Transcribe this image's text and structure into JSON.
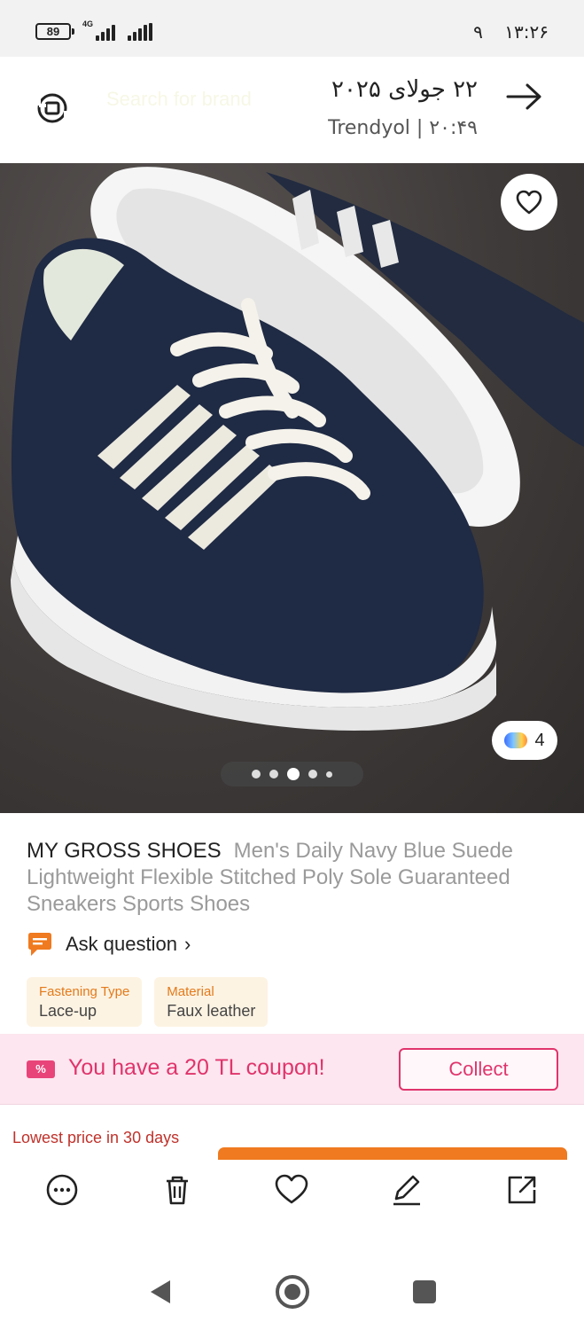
{
  "status_bar": {
    "battery": "89",
    "network": "4G",
    "time": "۱۳:۲۶",
    "notification_count": "۹"
  },
  "header": {
    "date": "۲۲ جولای ۲۰۲۵",
    "source": "Trendyol | ۲۰:۴۹",
    "ghost_search": "Search for brand"
  },
  "gallery": {
    "colors_count": "4",
    "pages": 5,
    "active_page": 3
  },
  "product": {
    "brand": "MY GROSS SHOES",
    "name": "Men's Daily Navy Blue Suede Lightweight Flexible Stitched Poly Sole Guaranteed Sneakers Sports Shoes",
    "ask_label": "Ask question",
    "attributes": [
      {
        "name": "Fastening Type",
        "value": "Lace-up"
      },
      {
        "name": "Material",
        "value": "Faux leather"
      }
    ]
  },
  "coupon": {
    "icon_text": "%",
    "text": "You have a 20 TL coupon!",
    "button": "Collect"
  },
  "price": {
    "lowest_label": "Lowest price in 30 days"
  },
  "colors": {
    "accent_orange": "#ef7a1f",
    "coupon_pink": "#e0346c",
    "lowest_red": "#c0322b"
  },
  "toolbar_icons": [
    "more-icon",
    "trash-icon",
    "heart-icon",
    "edit-icon",
    "share-icon"
  ]
}
